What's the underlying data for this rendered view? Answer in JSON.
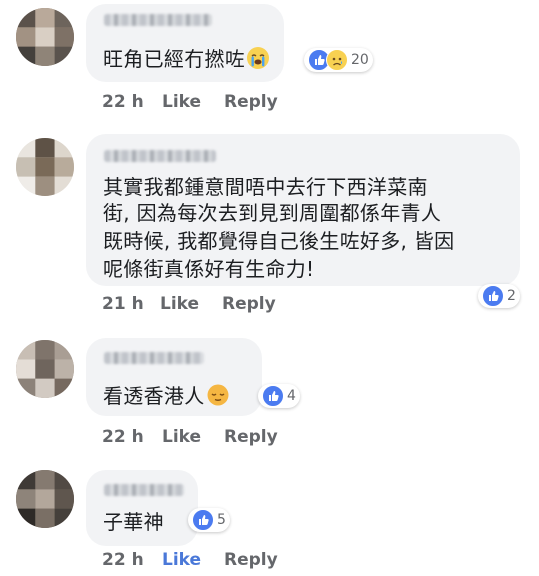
{
  "comments": [
    {
      "text": "旺角已經冇撚咗",
      "time": "22 h",
      "like": "Like",
      "reply": "Reply",
      "reaction_count": "20",
      "reactions": [
        "like-icon",
        "sad-icon"
      ]
    },
    {
      "lines": [
        "其實我都鍾意間唔中去行下西洋菜南",
        "街, 因為每次去到見到周圍都係年青人",
        "既時候, 我都覺得自己後生咗好多, 皆因",
        "呢條街真係好有生命力!"
      ],
      "time": "21 h",
      "like": "Like",
      "reply": "Reply",
      "reaction_count": "2",
      "reactions": [
        "like-icon"
      ]
    },
    {
      "text": "看透香港人",
      "time": "22 h",
      "like": "Like",
      "reply": "Reply",
      "reaction_count": "4",
      "reactions": [
        "like-icon"
      ]
    },
    {
      "text": "子華神",
      "time": "22 h",
      "like": "Like",
      "reply": "Reply",
      "reaction_count": "5",
      "reactions": [
        "like-icon"
      ]
    }
  ],
  "colors": {
    "bubble": "#f2f3f5",
    "like_blue": "#4b7bf0",
    "meta_gray": "#65676b",
    "like_active": "#4a78d8"
  }
}
